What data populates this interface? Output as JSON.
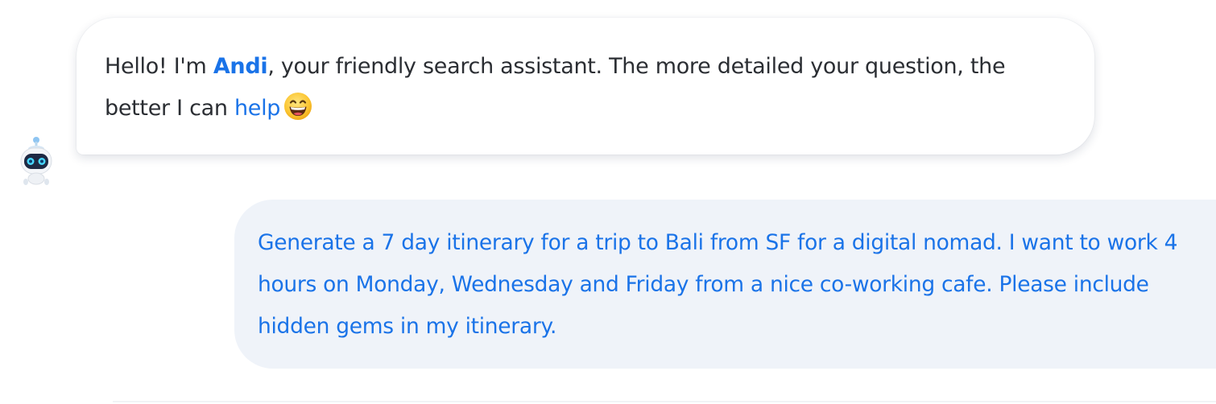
{
  "assistant_message": {
    "greeting": "Hello! I'm ",
    "assistant_name": "Andi",
    "text_after_name": ", your friendly search assistant. The more detailed your question, the better I can ",
    "help_link": "help",
    "emoji_icon": "grinning-face-emoji",
    "avatar_icon": "robot-avatar-icon"
  },
  "user_message": {
    "text": "Generate a 7 day itinerary for a trip to Bali from SF for a digital nomad. I want to work 4 hours on Monday, Wednesday and Friday from a nice co-working cafe. Please include hidden gems in my itinerary."
  },
  "colors": {
    "accent": "#1a73e8",
    "body_text": "#2b2e33",
    "user_bubble_bg": "#eff3f9"
  }
}
